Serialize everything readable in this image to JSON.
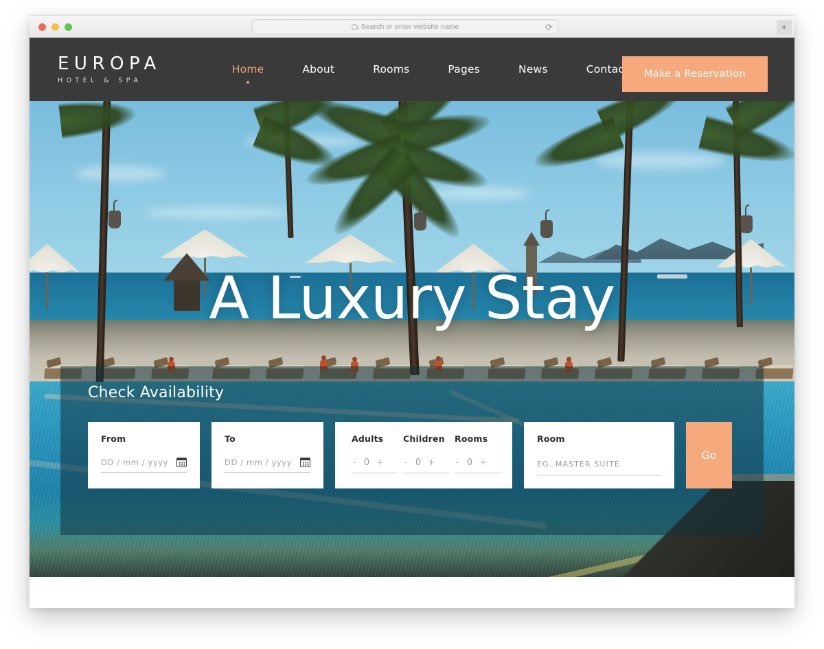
{
  "browser": {
    "search_placeholder": "Search or enter website name",
    "search_icon": "search-icon",
    "reload_icon": "⟳",
    "newtab_label": "+",
    "traffic_lights": [
      "close",
      "minimize",
      "maximize"
    ]
  },
  "header": {
    "logo_main": "EUROPA",
    "logo_sub": "HOTEL & SPA",
    "nav": [
      {
        "label": "Home",
        "active": true
      },
      {
        "label": "About",
        "active": false
      },
      {
        "label": "Rooms",
        "active": false
      },
      {
        "label": "Pages",
        "active": false
      },
      {
        "label": "News",
        "active": false
      },
      {
        "label": "Contact",
        "active": false
      }
    ],
    "reserve_button": "Make a Reservation"
  },
  "hero": {
    "title": "A Luxury Stay"
  },
  "booking": {
    "title": "Check Availability",
    "from": {
      "label": "From",
      "placeholder": "DD / mm / yyyy",
      "icon": "calendar-icon"
    },
    "to": {
      "label": "To",
      "placeholder": "DD / mm / yyyy",
      "icon": "calendar-icon"
    },
    "counters": [
      {
        "label": "Adults",
        "value": "0",
        "minus": "-",
        "plus": "+"
      },
      {
        "label": "Children",
        "value": "0",
        "minus": "-",
        "plus": "+"
      },
      {
        "label": "Rooms",
        "value": "0",
        "minus": "-",
        "plus": "+"
      }
    ],
    "room": {
      "label": "Room",
      "placeholder": "EG. MASTER SUITE"
    },
    "go_button": "Go"
  },
  "colors": {
    "accent": "#f5a97c",
    "header_bg": "#3a3a3a",
    "panel_overlay": "rgba(18,48,58,0.52)",
    "active_nav": "#f0a175"
  }
}
